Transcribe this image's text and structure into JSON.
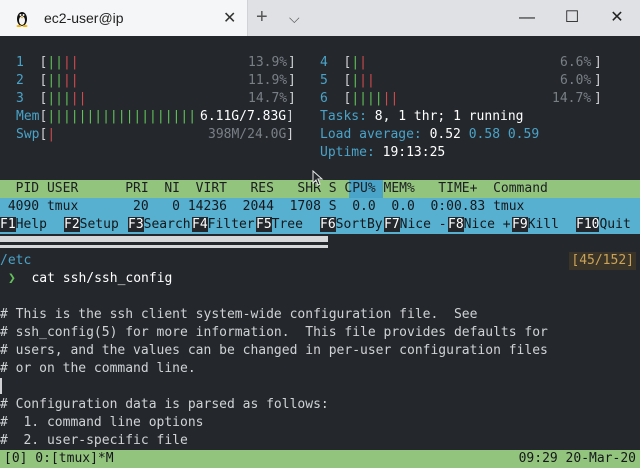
{
  "tab": {
    "title": "ec2-user@ip",
    "close": "✕"
  },
  "window": {
    "new_tab": "+",
    "dropdown": "⌵",
    "minimize": "—",
    "maximize": "☐",
    "close": "✕"
  },
  "htop": {
    "cpus": [
      {
        "num": "1",
        "green": "||",
        "red": "||",
        "pct": "13.9%"
      },
      {
        "num": "2",
        "green": "||",
        "red": "||",
        "pct": "11.9%"
      },
      {
        "num": "3",
        "green": "|||",
        "red": "||",
        "pct": "14.7%"
      },
      {
        "num": "4",
        "green": "|",
        "red": "|",
        "pct": "6.6%"
      },
      {
        "num": "5",
        "green": "|",
        "red": "||",
        "pct": "6.0%"
      },
      {
        "num": "6",
        "green": "||||",
        "red": "||",
        "pct": "14.7%"
      }
    ],
    "mem": {
      "label": "Mem",
      "bars": "|||||||||||||||||||",
      "value": "6.11G/7.83G"
    },
    "swp": {
      "label": "Swp",
      "bars": "|",
      "value": "398M/24.0G"
    },
    "tasks": {
      "label": "Tasks: ",
      "text": "8, 1 thr; 1 running"
    },
    "load": {
      "label": "Load average: ",
      "v1": "0.52",
      "v2": "0.58",
      "v3": "0.59"
    },
    "uptime": {
      "label": "Uptime: ",
      "value": "19:13:25"
    },
    "columns": "  PID USER      PRI  NI  VIRT   RES   SHR S CPU% MEM%   TIME+  Command",
    "process_row": " 4090 tmux       20   0 14236  2044  1708 S  0.0  0.0  0:00.83 tmux",
    "fkeys": [
      {
        "key": "F1",
        "label": "Help"
      },
      {
        "key": "F2",
        "label": "Setup"
      },
      {
        "key": "F3",
        "label": "Search"
      },
      {
        "key": "F4",
        "label": "Filter"
      },
      {
        "key": "F5",
        "label": "Tree"
      },
      {
        "key": "F6",
        "label": "SortBy"
      },
      {
        "key": "F7",
        "label": "Nice -"
      },
      {
        "key": "F8",
        "label": "Nice +"
      },
      {
        "key": "F9",
        "label": "Kill"
      },
      {
        "key": "F10",
        "label": "Quit"
      }
    ]
  },
  "pane2": {
    "cwd": "/etc",
    "position": "[45/152]",
    "prompt_symbol": "❯",
    "command": "cat ssh/ssh_config",
    "lines": [
      "# This is the ssh client system-wide configuration file.  See",
      "# ssh_config(5) for more information.  This file provides defaults for",
      "# users, and the values can be changed in per-user configuration files",
      "# or on the command line.",
      "",
      "# Configuration data is parsed as follows:",
      "#  1. command line options",
      "#  2. user-specific file"
    ]
  },
  "status": {
    "left": "[0] 0:[tmux]*M",
    "right": "09:29 20-Mar-20"
  }
}
